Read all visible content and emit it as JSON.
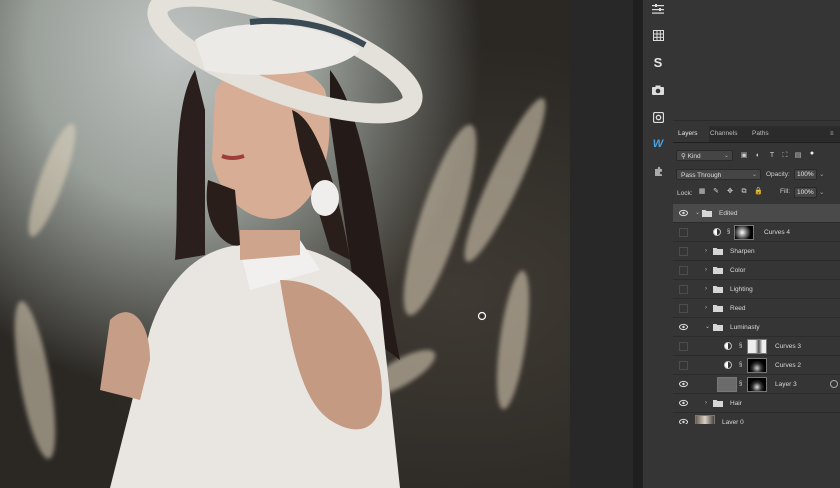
{
  "layers_panel": {
    "tabs": [
      {
        "label": "Layers",
        "active": true
      },
      {
        "label": "Channels",
        "active": false
      },
      {
        "label": "Paths",
        "active": false
      }
    ],
    "filter_kind": "Kind",
    "blend_mode": "Pass Through",
    "opacity_label": "Opacity:",
    "opacity_value": "100%",
    "lock_label": "Lock:",
    "fill_label": "Fill:",
    "fill_value": "100%",
    "layers": [
      {
        "name": "Edited",
        "type": "group",
        "visible": true,
        "expanded": true,
        "selected": true
      },
      {
        "name": "Curves 4",
        "type": "adjustment",
        "visible": false
      },
      {
        "name": "Sharpen",
        "type": "group",
        "visible": false,
        "expanded": false
      },
      {
        "name": "Color",
        "type": "group",
        "visible": false,
        "expanded": false
      },
      {
        "name": "Lighting",
        "type": "group",
        "visible": false,
        "expanded": false
      },
      {
        "name": "Reed",
        "type": "group",
        "visible": false,
        "expanded": false
      },
      {
        "name": "Luminasty",
        "type": "group",
        "visible": true,
        "expanded": true
      },
      {
        "name": "Curves 3",
        "type": "adjustment",
        "visible": false
      },
      {
        "name": "Curves 2",
        "type": "adjustment",
        "visible": false
      },
      {
        "name": "Layer 3",
        "type": "pixel-masked",
        "visible": true
      },
      {
        "name": "Hair",
        "type": "group",
        "visible": true,
        "expanded": false
      },
      {
        "name": "Layer 0",
        "type": "pixel",
        "visible": true
      }
    ]
  },
  "side_tools": [
    {
      "icon": "properties-sliders-icon"
    },
    {
      "icon": "grid-icon"
    },
    {
      "label": "S",
      "icon": "s-plugin-icon"
    },
    {
      "icon": "camera-icon"
    },
    {
      "icon": "camera-raw-icon"
    },
    {
      "label": "W",
      "icon": "w-plugin-icon"
    },
    {
      "icon": "puzzle-icon"
    }
  ]
}
